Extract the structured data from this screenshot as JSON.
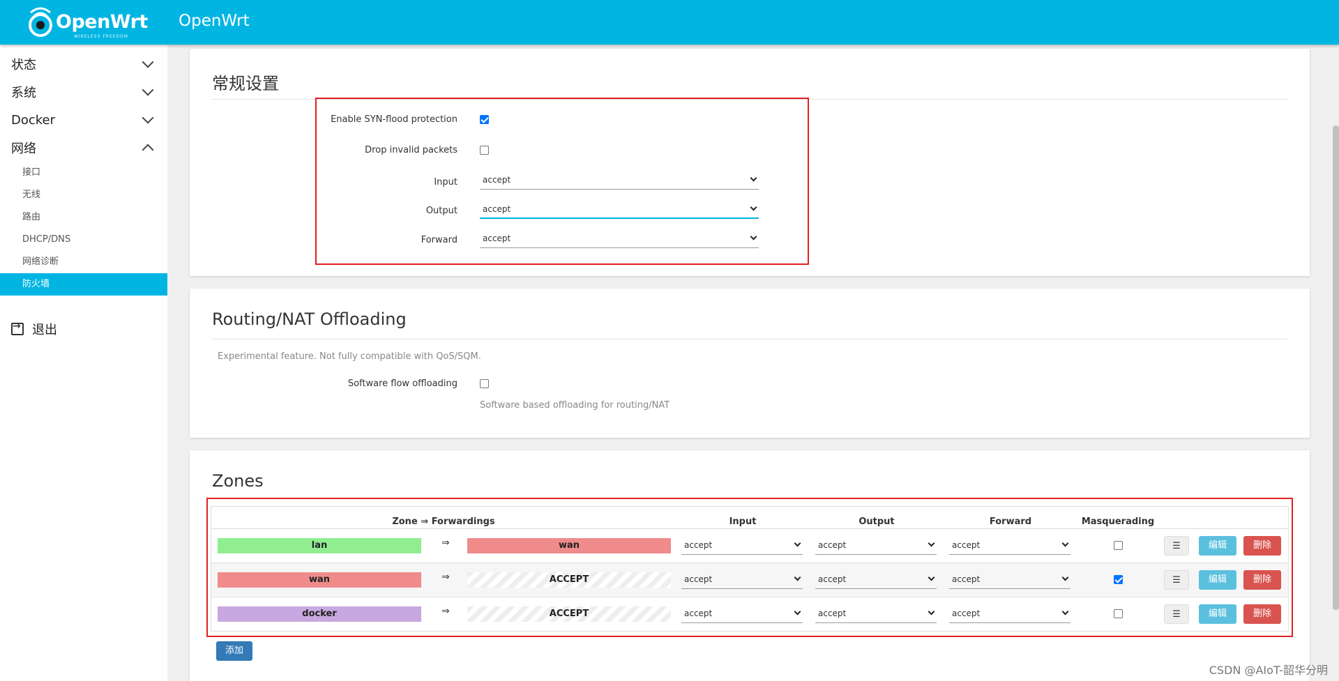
{
  "header": {
    "logo_text": "OpenWrt",
    "logo_tagline": "WIRELESS FREEDOM",
    "title": "OpenWrt"
  },
  "sidebar": {
    "menus": [
      {
        "label": "状态",
        "expanded": false
      },
      {
        "label": "系统",
        "expanded": false
      },
      {
        "label": "Docker",
        "expanded": false
      },
      {
        "label": "网络",
        "expanded": true
      }
    ],
    "network_items": [
      "接口",
      "无线",
      "路由",
      "DHCP/DNS",
      "网络诊断",
      "防火墙"
    ],
    "active_item": "防火墙",
    "logout": "退出"
  },
  "general": {
    "title": "常规设置",
    "syn_flood": {
      "label": "Enable SYN-flood protection",
      "checked": true
    },
    "drop_invalid": {
      "label": "Drop invalid packets",
      "checked": false
    },
    "input": {
      "label": "Input",
      "value": "accept"
    },
    "output": {
      "label": "Output",
      "value": "accept"
    },
    "forward": {
      "label": "Forward",
      "value": "accept"
    }
  },
  "offload": {
    "title": "Routing/NAT Offloading",
    "description": "Experimental feature. Not fully compatible with QoS/SQM.",
    "sw_flow": {
      "label": "Software flow offloading",
      "checked": false,
      "help": "Software based offloading for routing/NAT"
    }
  },
  "zones": {
    "title": "Zones",
    "columns": {
      "zone": "Zone ⇒ Forwardings",
      "input": "Input",
      "output": "Output",
      "forward": "Forward",
      "masq": "Masquerading"
    },
    "arrow": "⇒",
    "rows": [
      {
        "zone": "lan",
        "zone_color": "#90ee90",
        "dest": "wan",
        "dest_color": "#f08b8b",
        "input": "accept",
        "output": "accept",
        "forward": "accept",
        "masq": false
      },
      {
        "zone": "wan",
        "zone_color": "#f08b8b",
        "dest": "ACCEPT",
        "dest_color": "hatched",
        "input": "accept",
        "output": "accept",
        "forward": "accept",
        "masq": true
      },
      {
        "zone": "docker",
        "zone_color": "#c8a8e0",
        "dest": "ACCEPT",
        "dest_color": "hatched",
        "input": "accept",
        "output": "accept",
        "forward": "accept",
        "masq": false
      }
    ],
    "buttons": {
      "menu": "☰",
      "edit": "编辑",
      "delete": "删除"
    },
    "add_label": "添加"
  },
  "watermark": "CSDN @AIoT-韶华分明",
  "colors": {
    "header": "#00b5e2",
    "active": "#00b5e2",
    "highlight_border": "#e02020",
    "edit": "#5bc0de",
    "delete": "#d9534f",
    "add": "#337ab7"
  }
}
